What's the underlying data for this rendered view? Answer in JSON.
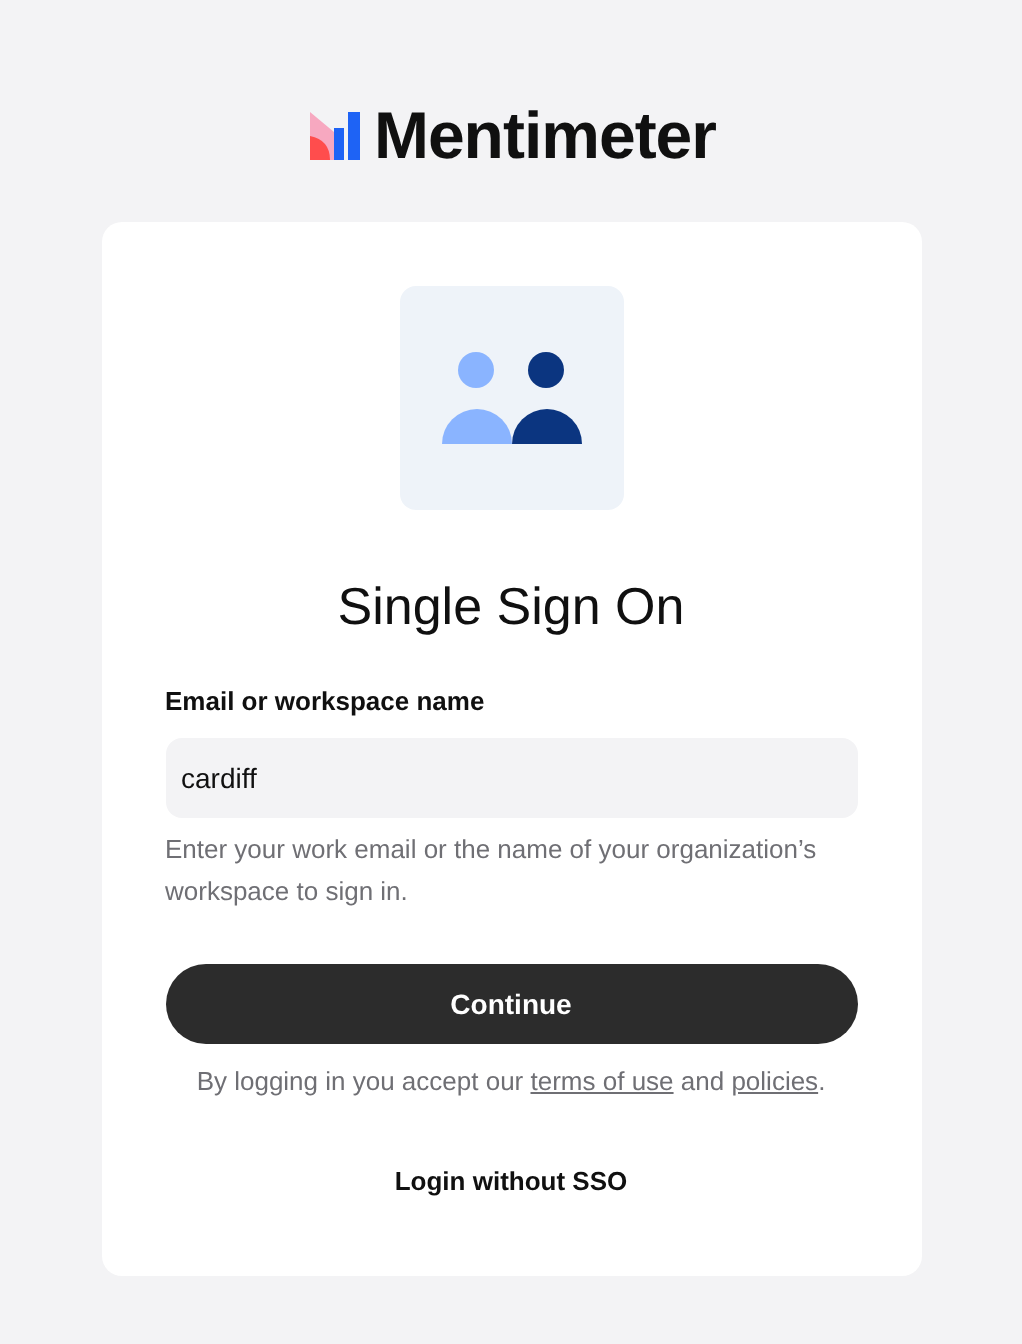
{
  "brand": {
    "name": "Mentimeter"
  },
  "title": "Single Sign On",
  "field": {
    "label": "Email or workspace name",
    "value": "cardiff",
    "help": "Enter your work email or the name of your organization’s workspace to sign in."
  },
  "button": "Continue",
  "legal": [
    {
      "kind": "text",
      "text": "By logging in you accept our "
    },
    {
      "kind": "link",
      "text": "terms of use"
    },
    {
      "kind": "text",
      "text": " and "
    },
    {
      "kind": "link",
      "text": "policies"
    },
    {
      "kind": "text",
      "text": "."
    }
  ],
  "alt_login": "Login without SSO"
}
